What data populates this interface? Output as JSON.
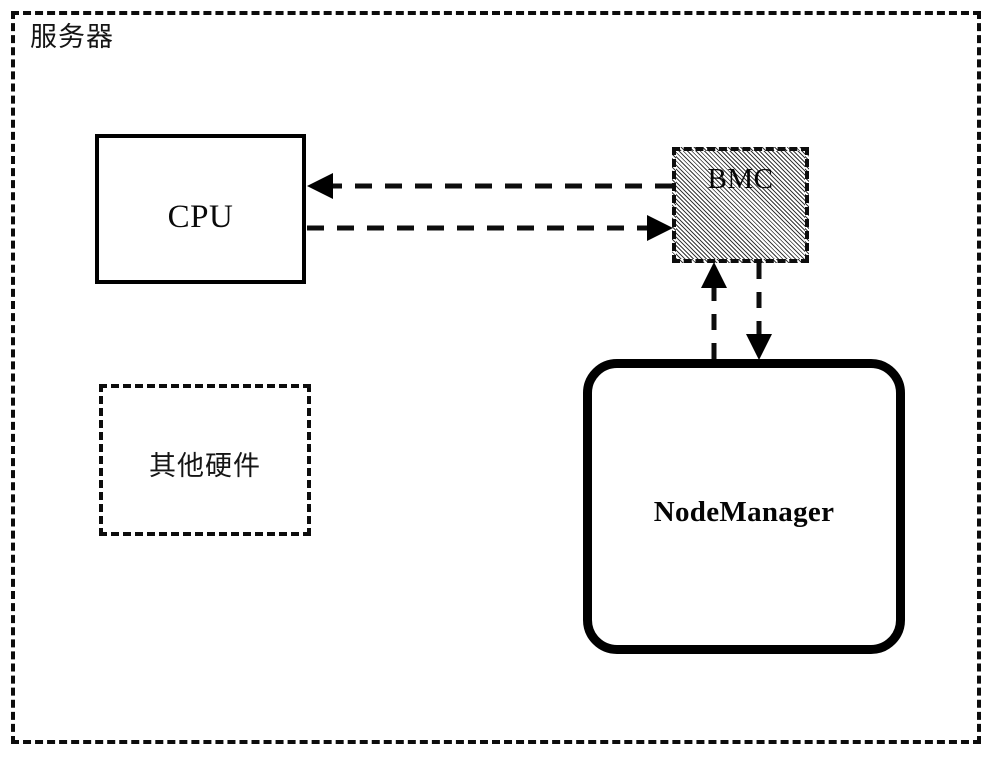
{
  "diagram": {
    "title_label": "服务器",
    "nodes": {
      "server": {
        "label": "服务器",
        "shape": "dashed-rectangle",
        "role": "outer-container"
      },
      "cpu": {
        "label": "CPU",
        "shape": "solid-rectangle",
        "fill": "#ffffff",
        "border_color": "#000000"
      },
      "other_hardware": {
        "label": "其他硬件",
        "shape": "dashed-rectangle",
        "fill": "#ffffff",
        "border_color": "#0d0d0d"
      },
      "bmc": {
        "label": "BMC",
        "shape": "dashed-rectangle",
        "fill": "hatched",
        "fill_color": "#bdbdbd",
        "border_color": "#0d0d0d"
      },
      "nodemanager": {
        "label": "NodeManager",
        "shape": "rounded-rectangle",
        "fill": "#ffffff",
        "border_color": "#000000"
      }
    },
    "connectors": [
      {
        "id": "bmc-to-cpu",
        "from": "bmc",
        "to": "cpu",
        "style": "dashed",
        "arrow": "left",
        "label": ""
      },
      {
        "id": "cpu-to-bmc",
        "from": "cpu",
        "to": "bmc",
        "style": "dashed",
        "arrow": "right",
        "label": ""
      },
      {
        "id": "nodemanager-to-bmc",
        "from": "nodemanager",
        "to": "bmc",
        "style": "dashed",
        "arrow": "up",
        "label": ""
      },
      {
        "id": "bmc-to-nodemanager",
        "from": "bmc",
        "to": "nodemanager",
        "style": "dashed",
        "arrow": "down",
        "label": ""
      }
    ],
    "colors": {
      "stroke": "#000000",
      "dashed_stroke": "#0d0d0d",
      "background": "#ffffff",
      "hatch": "#3a3a3a"
    }
  }
}
